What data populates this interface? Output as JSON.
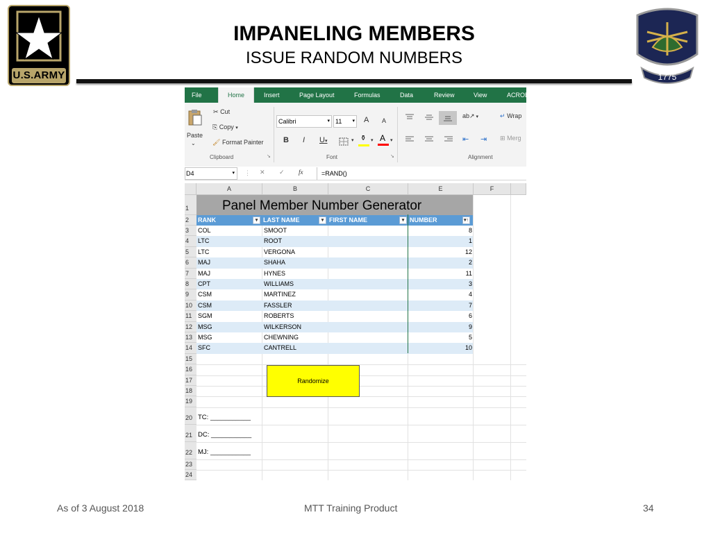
{
  "slide": {
    "title": "IMPANELING MEMBERS",
    "subtitle": "ISSUE RANDOM NUMBERS",
    "army_logo_text": "U.S.ARMY",
    "crest_year": "1775",
    "footer_left": "As of 3 August 2018",
    "footer_center": "MTT Training Product",
    "page_number": "34"
  },
  "excel": {
    "tabs": [
      "File",
      "Home",
      "Insert",
      "Page Layout",
      "Formulas",
      "Data",
      "Review",
      "View",
      "ACROB"
    ],
    "active_tab": "Home",
    "clipboard": {
      "paste": "Paste",
      "cut": "Cut",
      "copy": "Copy",
      "format_painter": "Format Painter",
      "group_label": "Clipboard"
    },
    "font": {
      "name": "Calibri",
      "size": "11",
      "bold": "B",
      "italic": "I",
      "underline": "U",
      "grow": "A",
      "shrink": "A",
      "color_letter": "A",
      "group_label": "Font"
    },
    "alignment": {
      "wrap": "Wrap",
      "merge": "Merg",
      "group_label": "Alignment"
    },
    "name_box": "D4",
    "fx": "fx",
    "formula": "=RAND()",
    "columns": [
      "A",
      "B",
      "C",
      "E",
      "F"
    ],
    "banner": "Panel Member Number Generator",
    "table_headers": [
      "RANK",
      "LAST NAME",
      "FIRST NAME",
      "NUMBER"
    ],
    "rows": [
      {
        "rank": "COL",
        "last": "SMOOT",
        "first": "",
        "number": "8"
      },
      {
        "rank": "LTC",
        "last": "ROOT",
        "first": "",
        "number": "1"
      },
      {
        "rank": "LTC",
        "last": "VERGONA",
        "first": "",
        "number": "12"
      },
      {
        "rank": "MAJ",
        "last": "SHAHA",
        "first": "",
        "number": "2"
      },
      {
        "rank": "MAJ",
        "last": "HYNES",
        "first": "",
        "number": "11"
      },
      {
        "rank": "CPT",
        "last": "WILLIAMS",
        "first": "",
        "number": "3"
      },
      {
        "rank": "CSM",
        "last": "MARTINEZ",
        "first": "",
        "number": "4"
      },
      {
        "rank": "CSM",
        "last": "FASSLER",
        "first": "",
        "number": "7"
      },
      {
        "rank": "SGM",
        "last": "ROBERTS",
        "first": "",
        "number": "6"
      },
      {
        "rank": "MSG",
        "last": "WILKERSON",
        "first": "",
        "number": "9"
      },
      {
        "rank": "MSG",
        "last": "CHEWNING",
        "first": "",
        "number": "5"
      },
      {
        "rank": "SFC",
        "last": "CANTRELL",
        "first": "",
        "number": "10"
      }
    ],
    "row_numbers": [
      "1",
      "2",
      "3",
      "4",
      "5",
      "6",
      "7",
      "8",
      "9",
      "10",
      "11",
      "12",
      "13",
      "14",
      "15",
      "16",
      "17",
      "18",
      "19",
      "20",
      "21",
      "22",
      "23",
      "24"
    ],
    "button_label": "Randomize",
    "signatures": [
      "TC: ___________",
      "DC: ___________",
      "MJ: ___________"
    ]
  }
}
